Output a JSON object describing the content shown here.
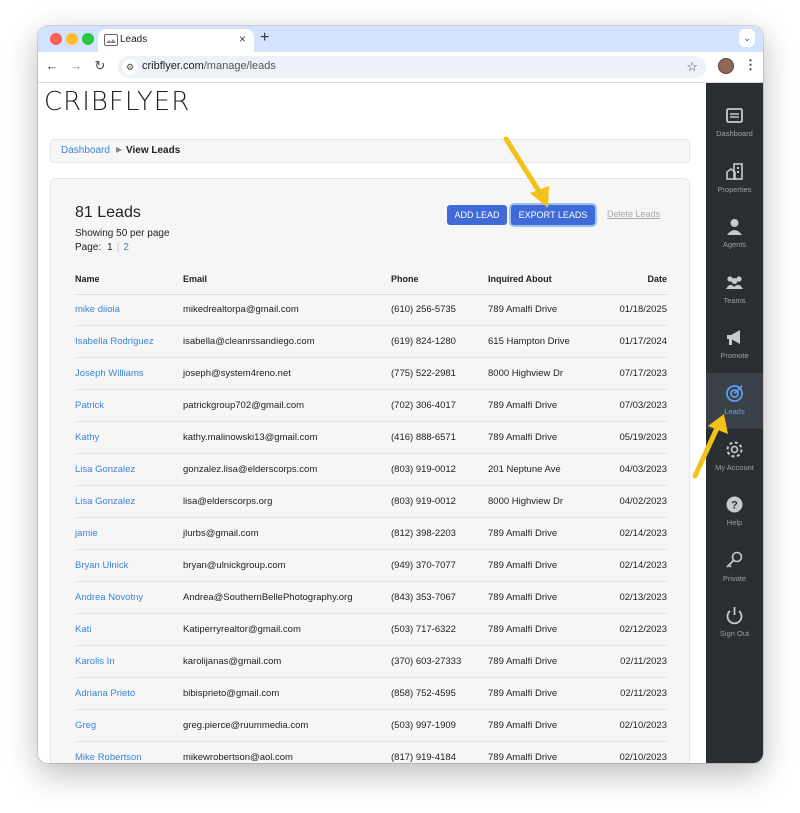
{
  "browser": {
    "tab_title": "Leads",
    "tab_close": "×",
    "new_tab": "+",
    "url_domain": "cribflyer.com",
    "url_path": "/manage/leads"
  },
  "app": {
    "logo": "CRIBFLYER",
    "breadcrumb": {
      "home": "Dashboard",
      "current": "View Leads"
    }
  },
  "leads": {
    "title": "81 Leads",
    "showing": "Showing 50 per page",
    "page_label": "Page:",
    "pages": [
      "1",
      "2"
    ],
    "add_button": "ADD LEAD",
    "export_button": "EXPORT LEADS",
    "delete_link": "Delete Leads",
    "columns": [
      "Name",
      "Email",
      "Phone",
      "Inquired About",
      "Date"
    ],
    "rows": [
      [
        "mike diioia",
        "mikedrealtorpa@gmail.com",
        "(610) 256-5735",
        "789 Amalfi Drive",
        "01/18/2025"
      ],
      [
        "Isabella Rodriguez",
        "isabella@cleanrssandiego.com",
        "(619) 824-1280",
        "615 Hampton Drive",
        "01/17/2024"
      ],
      [
        "Joseph Williams",
        "joseph@system4reno.net",
        "(775) 522-2981",
        "8000 Highview Dr",
        "07/17/2023"
      ],
      [
        "Patrick",
        "patrickgroup702@gmail.com",
        "(702) 306-4017",
        "789 Amalfi Drive",
        "07/03/2023"
      ],
      [
        "Kathy",
        "kathy.malinowski13@gmail.com",
        "(416) 888-6571",
        "789 Amalfi Drive",
        "05/19/2023"
      ],
      [
        "Lisa Gonzalez",
        "gonzalez.lisa@elderscorps.com",
        "(803) 919-0012",
        "201 Neptune Ave",
        "04/03/2023"
      ],
      [
        "Lisa Gonzalez",
        "lisa@elderscorps.org",
        "(803) 919-0012",
        "8000 Highview Dr",
        "04/02/2023"
      ],
      [
        "jamie",
        "jlurbs@gmail.com",
        "(812) 398-2203",
        "789 Amalfi Drive",
        "02/14/2023"
      ],
      [
        "Bryan Ulnick",
        "bryan@ulnickgroup.com",
        "(949) 370-7077",
        "789 Amalfi Drive",
        "02/14/2023"
      ],
      [
        "Andrea Novotny",
        "Andrea@SouthernBellePhotography.org",
        "(843) 353-7067",
        "789 Amalfi Drive",
        "02/13/2023"
      ],
      [
        "Kati",
        "Katiperryrealtor@gmail.com",
        "(503) 717-6322",
        "789 Amalfi Drive",
        "02/12/2023"
      ],
      [
        "Karolis In",
        "karolijanas@gmail.com",
        "(370) 603-27333",
        "789 Amalfi Drive",
        "02/11/2023"
      ],
      [
        "Adriana Prieto",
        "bibisprieto@gmail.com",
        "(858) 752-4595",
        "789 Amalfi Drive",
        "02/11/2023"
      ],
      [
        "Greg",
        "greg.pierce@ruummedia.com",
        "(503) 997-1909",
        "789 Amalfi Drive",
        "02/10/2023"
      ],
      [
        "Mike Robertson",
        "mikewrobertson@aol.com",
        "(817) 919-4184",
        "789 Amalfi Drive",
        "02/10/2023"
      ]
    ]
  },
  "sidebar": {
    "items": [
      {
        "label": "Dashboard",
        "icon": "dashboard-icon"
      },
      {
        "label": "Properties",
        "icon": "properties-icon"
      },
      {
        "label": "Agents",
        "icon": "agent-icon"
      },
      {
        "label": "Teams",
        "icon": "teams-icon"
      },
      {
        "label": "Promote",
        "icon": "megaphone-icon"
      },
      {
        "label": "Leads",
        "icon": "target-icon"
      },
      {
        "label": "My Account",
        "icon": "gear-icon"
      },
      {
        "label": "Help",
        "icon": "help-icon"
      },
      {
        "label": "Private",
        "icon": "key-icon"
      },
      {
        "label": "Sign Out",
        "icon": "power-icon"
      }
    ],
    "active_index": 5
  },
  "colors": {
    "accent": "#3f6ad8",
    "link": "#3a85d6",
    "sidebar_bg": "#2a2e33",
    "annotation_arrow": "#f2c21a"
  }
}
